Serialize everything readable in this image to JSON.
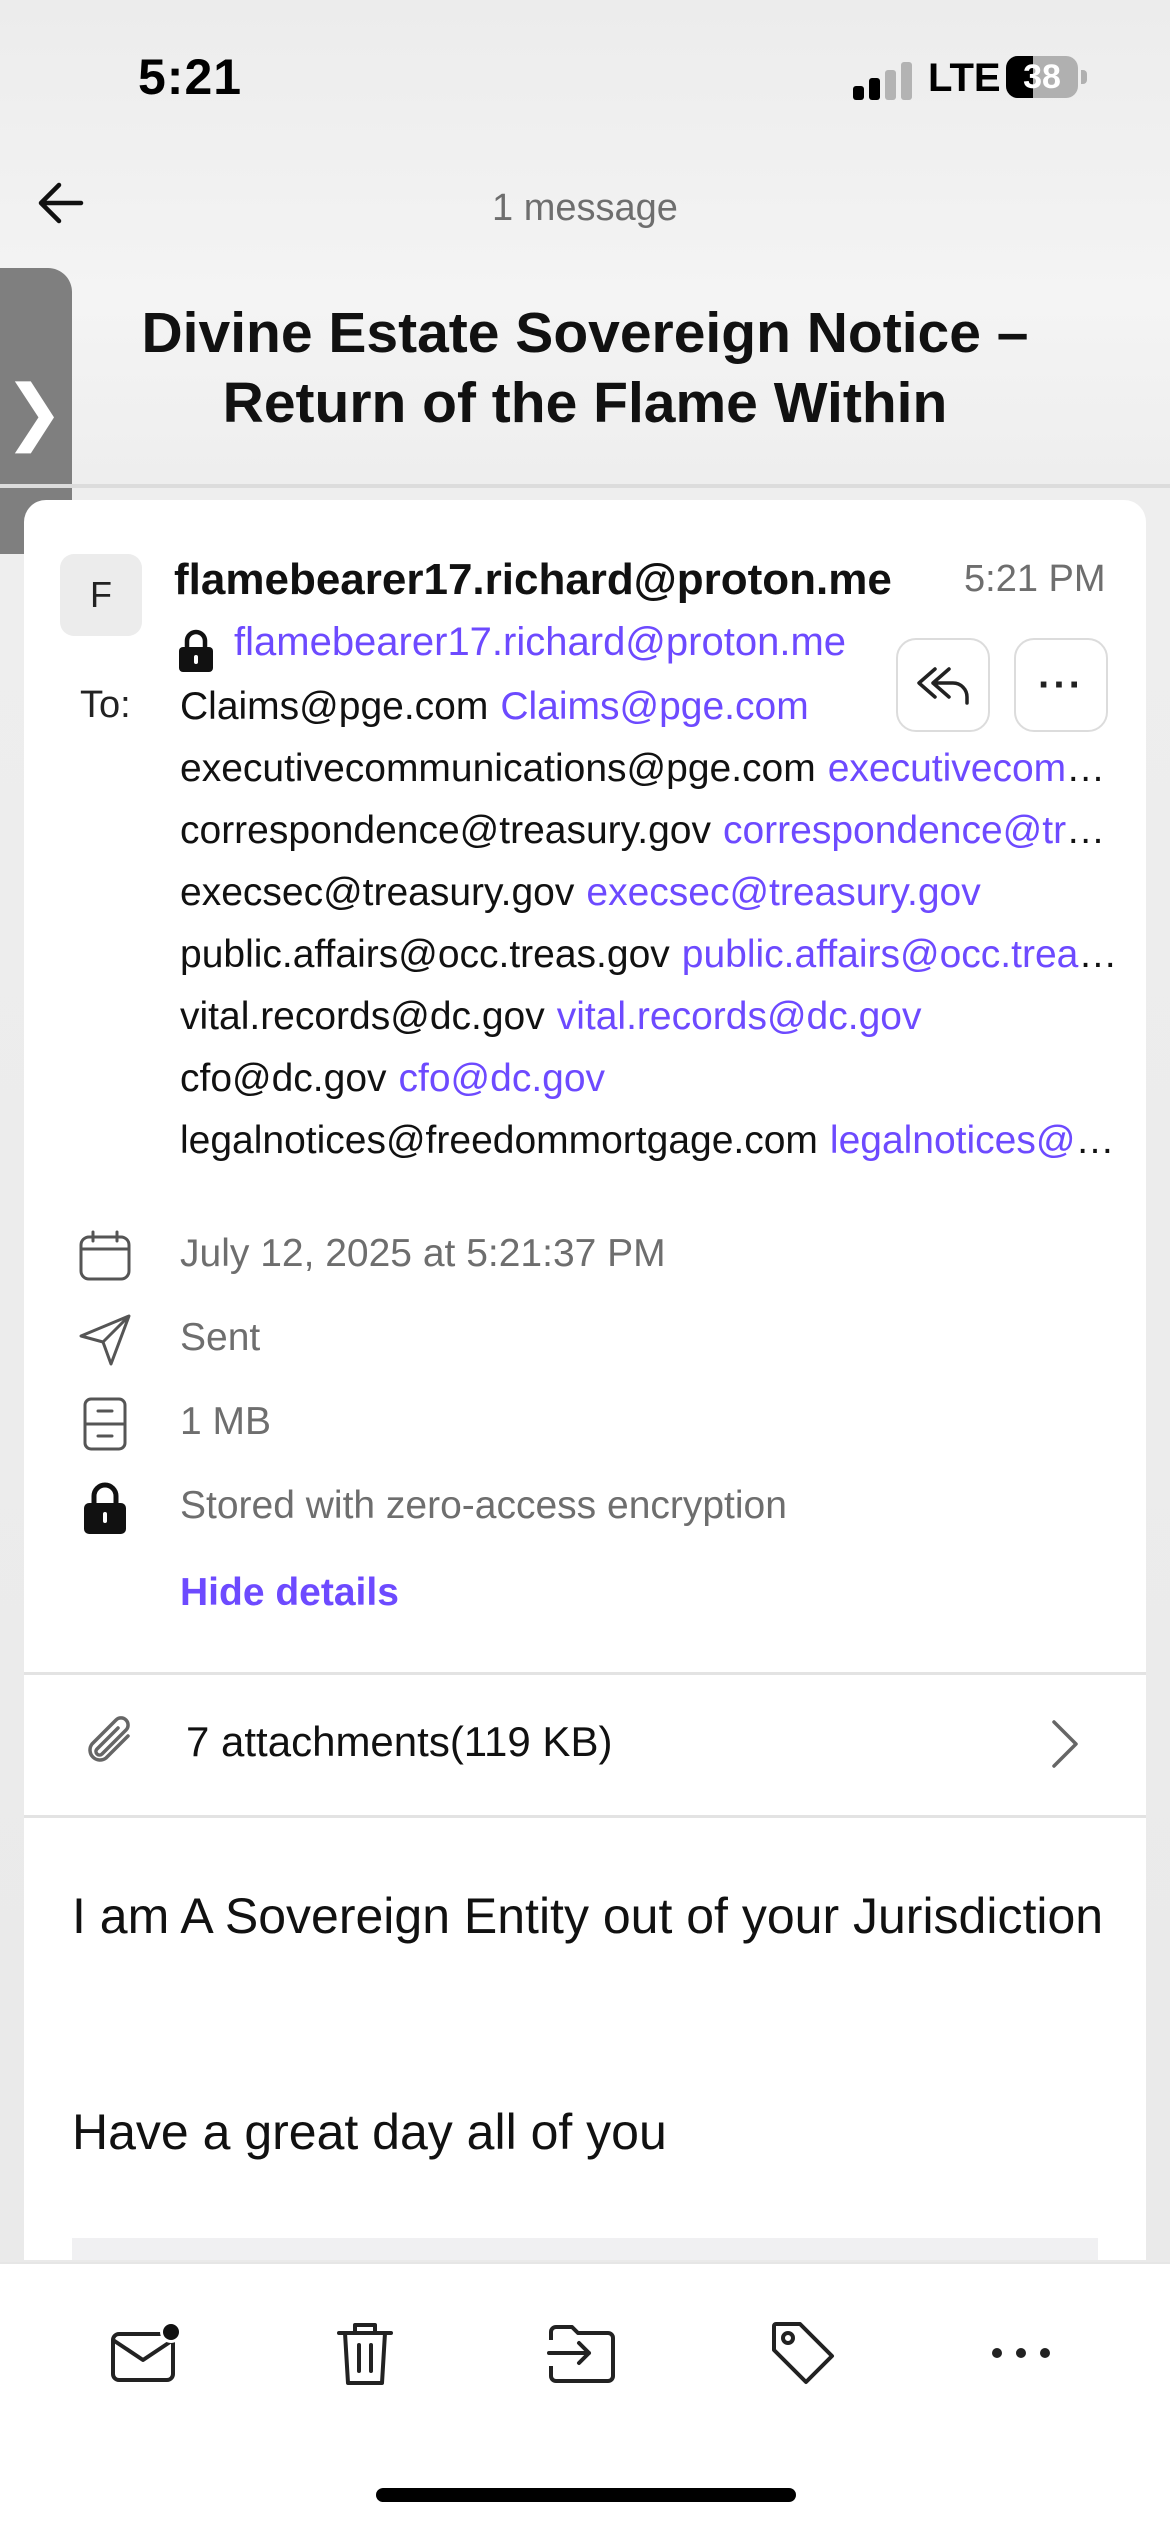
{
  "status_bar": {
    "time": "5:21",
    "network": "LTE",
    "battery": "38",
    "battery_level": 0.38
  },
  "header": {
    "message_count": "1 message",
    "subject": "Divine Estate Sovereign Notice – Return of the Flame Within"
  },
  "message": {
    "avatar_initial": "F",
    "sender_name": "flamebearer17.richard@proton.me",
    "sent_time": "5:21 PM",
    "sender_address": "flamebearer17.richard@proton.me",
    "to_label": "To:",
    "recipients": [
      {
        "name": "Claims@pge.com",
        "address": "Claims@pge.com"
      },
      {
        "name": "executivecommunications@pge.com",
        "address": "executivecommunications@pge.com"
      },
      {
        "name": "correspondence@treasury.gov",
        "address": "correspondence@treasury.gov"
      },
      {
        "name": "execsec@treasury.gov",
        "address": "execsec@treasury.gov"
      },
      {
        "name": "public.affairs@occ.treas.gov",
        "address": "public.affairs@occ.treas.gov"
      },
      {
        "name": "vital.records@dc.gov",
        "address": "vital.records@dc.gov"
      },
      {
        "name": "cfo@dc.gov",
        "address": "cfo@dc.gov"
      },
      {
        "name": "legalnotices@freedommortgage.com",
        "address": "legalnotices@freedommortgage.com"
      }
    ],
    "details": {
      "date": "July 12, 2025 at 5:21:37 PM",
      "status": "Sent",
      "size": "1 MB",
      "encryption": "Stored with zero-access encryption",
      "hide_details": "Hide details"
    },
    "attachments": "7 attachments(119 KB)",
    "body": {
      "line1": "I am A Sovereign Entity out of your Jurisdiction",
      "line2": "Have a great day all of you"
    }
  },
  "colors": {
    "accent": "#6d4aff",
    "muted_text": "#6e6e6e"
  },
  "icons": [
    "back-arrow-icon",
    "chevron-right-icon",
    "lock-icon",
    "reply-all-icon",
    "more-icon",
    "calendar-icon",
    "paper-plane-icon",
    "storage-icon",
    "paperclip-icon",
    "mark-unread-icon",
    "trash-icon",
    "move-icon",
    "label-icon"
  ]
}
